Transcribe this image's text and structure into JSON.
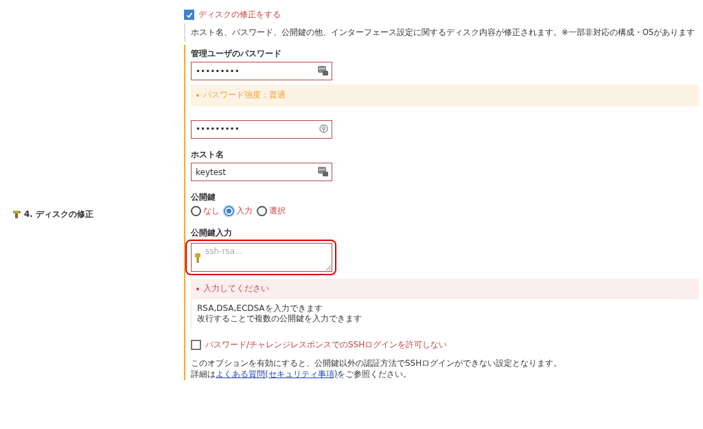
{
  "section": {
    "label": "4. ディスクの修正"
  },
  "enable_checkbox": {
    "label": "ディスクの修正をする",
    "checked": true
  },
  "description": "ホスト名、パスワード、公開鍵の他、インターフェース設定に関するディスク内容が修正されます。※一部非対応の構成・OSがあります",
  "password": {
    "label": "管理ユーザのパスワード",
    "value": "•••••••••",
    "strength_message": "パスワード強度：普通"
  },
  "password_confirm": {
    "value": "•••••••••"
  },
  "hostname": {
    "label": "ホスト名",
    "value": "keytest"
  },
  "public_key": {
    "label": "公開鍵",
    "options": [
      {
        "label": "なし",
        "selected": false
      },
      {
        "label": "入力",
        "selected": true
      },
      {
        "label": "選択",
        "selected": false
      }
    ]
  },
  "public_key_input": {
    "label": "公開鍵入力",
    "placeholder": "ssh-rsa...",
    "highlighted": true,
    "error": "入力してください",
    "help": [
      "RSA,DSA,ECDSAを入力できます",
      "改行することで複数の公開鍵を入力できます"
    ]
  },
  "ssh_checkbox": {
    "label": "パスワード/チャレンジレスポンスでのSSHログインを許可しない",
    "checked": false
  },
  "note": [
    "このオプションを有効にすると、公開鍵以外の認証方法でSSHログインができない設定となります。"
  ],
  "note_line2": {
    "before": "詳細は",
    "link": "よくある質問(セキュリティ事項)",
    "after": "をご参照ください。"
  }
}
